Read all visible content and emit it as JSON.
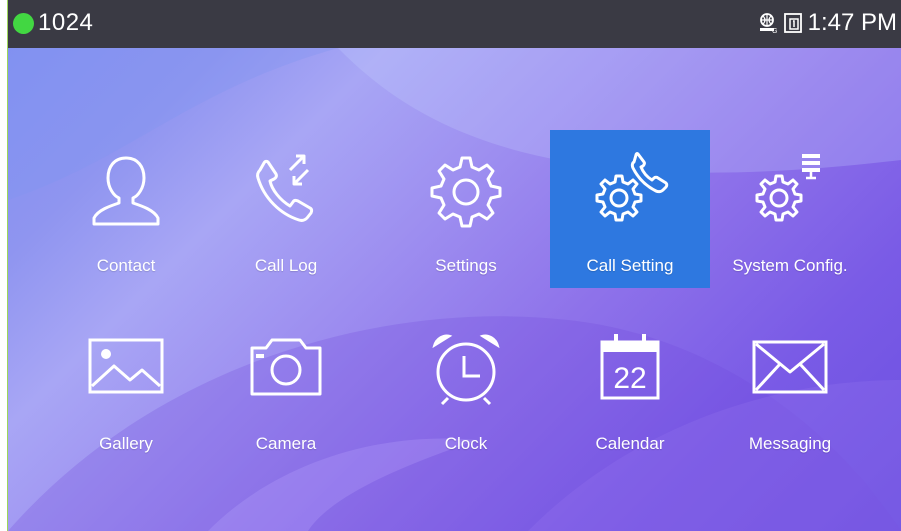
{
  "statusbar": {
    "extension": "1024",
    "time": "1:47 PM",
    "icons": [
      "network-icon",
      "sim-icon"
    ]
  },
  "colors": {
    "status_dot": "#42d742",
    "selected": "#2e78e0",
    "statusbar_bg": "#3a3a44"
  },
  "apps": [
    {
      "label": "Contact",
      "icon": "contact-icon",
      "selected": false
    },
    {
      "label": "Call Log",
      "icon": "call-log-icon",
      "selected": false
    },
    {
      "label": "Settings",
      "icon": "settings-gear-icon",
      "selected": false
    },
    {
      "label": "Call Setting",
      "icon": "call-setting-icon",
      "selected": true
    },
    {
      "label": "System Config.",
      "icon": "system-config-icon",
      "selected": false
    },
    {
      "label": "Gallery",
      "icon": "gallery-icon",
      "selected": false
    },
    {
      "label": "Camera",
      "icon": "camera-icon",
      "selected": false
    },
    {
      "label": "Clock",
      "icon": "alarm-clock-icon",
      "selected": false
    },
    {
      "label": "Calendar",
      "icon": "calendar-icon",
      "selected": false,
      "icon_text": "22"
    },
    {
      "label": "Messaging",
      "icon": "envelope-icon",
      "selected": false
    }
  ]
}
